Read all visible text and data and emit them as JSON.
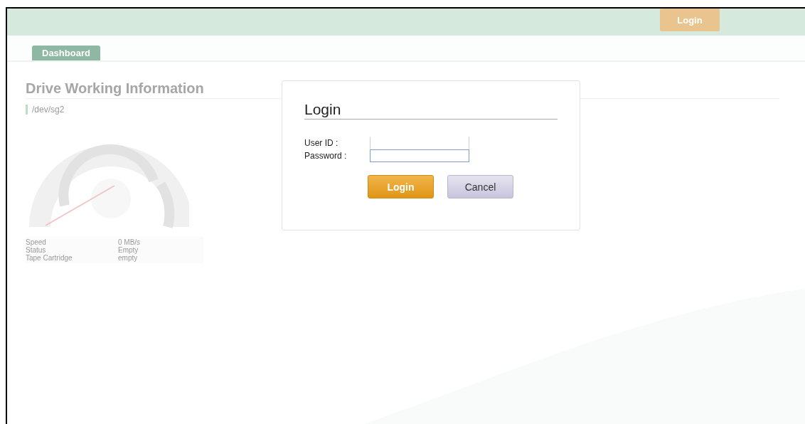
{
  "header": {
    "login_button": "Login"
  },
  "tabs": [
    {
      "label": "Dashboard",
      "selected": true
    }
  ],
  "section": {
    "title": "Drive Working Information",
    "device": "/dev/sg2",
    "info": [
      {
        "label": "Speed",
        "value": "0 MB/s"
      },
      {
        "label": "Status",
        "value": "Empty"
      },
      {
        "label": "Tape Cartridge",
        "value": "empty"
      }
    ]
  },
  "dialog": {
    "title": "Login",
    "fields": [
      {
        "label": "User ID :",
        "focused": false
      },
      {
        "label": "Password :",
        "focused": true
      }
    ],
    "buttons": [
      {
        "label": "Login",
        "kind": "primary"
      },
      {
        "label": "Cancel",
        "kind": "secondary"
      }
    ]
  }
}
